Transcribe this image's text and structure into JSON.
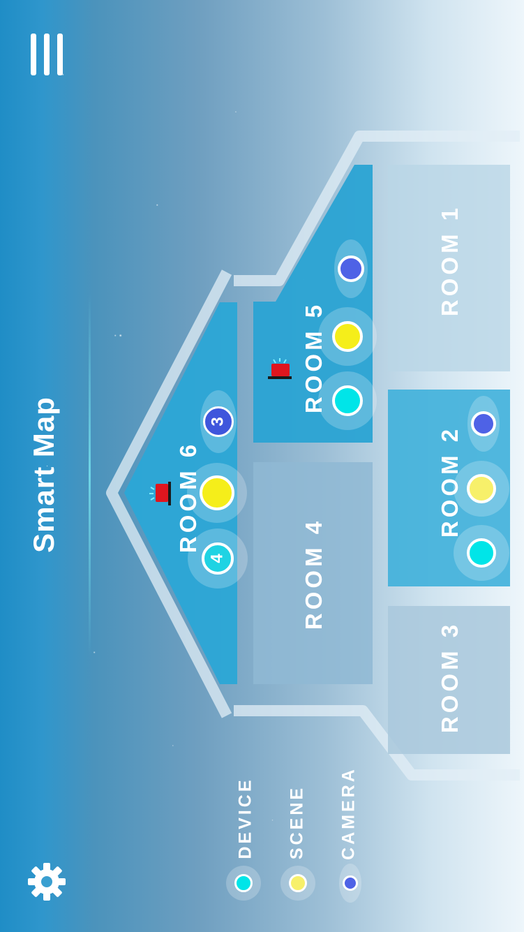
{
  "app": {
    "title": "Smart Map"
  },
  "rooms": [
    {
      "label": "ROOM 1"
    },
    {
      "label": "ROOM 2"
    },
    {
      "label": "ROOM 3"
    },
    {
      "label": "ROOM 4"
    },
    {
      "label": "ROOM 5"
    },
    {
      "label": "ROOM 6"
    }
  ],
  "legend": [
    {
      "label": "DEVICE",
      "color": "#00e5e8"
    },
    {
      "label": "SCENE",
      "color": "#f7f06a"
    },
    {
      "label": "CAMERA",
      "color": "#5a6fe8"
    }
  ],
  "badges": {
    "room6_camera_count": "3",
    "room6_device_count": "4"
  },
  "icons": {
    "menu": "hamburger-menu-icon",
    "settings": "gear-icon",
    "alarm": "siren-icon"
  },
  "colors": {
    "device": "#00e5e8",
    "scene": "#f5ee2a",
    "camera": "#4b5de0",
    "alarm": "#e0161e"
  }
}
